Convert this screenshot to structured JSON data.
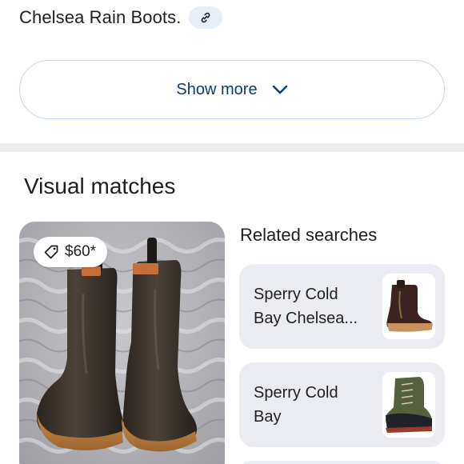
{
  "description_tail": "Chelsea Rain Boots.",
  "link_icon": "link-icon",
  "show_more": {
    "label": "Show more",
    "icon": "chevron-down-icon"
  },
  "visual_matches": {
    "title": "Visual matches",
    "items": [
      {
        "price": "$60*",
        "icon": "price-tag-icon"
      }
    ]
  },
  "related_searches": {
    "title": "Related searches",
    "items": [
      {
        "lines": [
          "Sperry Cold",
          "Bay Chelsea..."
        ]
      },
      {
        "lines": [
          "Sperry Cold",
          "Bay"
        ]
      }
    ]
  },
  "colors": {
    "accent_text": "#0b3b73",
    "chip_bg": "#e8eef8",
    "card_bg": "#eaecf1",
    "divider": "#ececef"
  }
}
